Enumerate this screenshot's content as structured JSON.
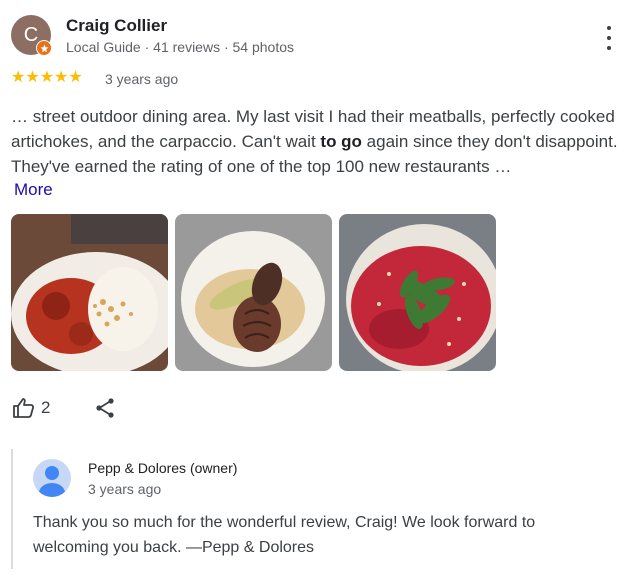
{
  "reviewer": {
    "name": "Craig Collier",
    "initial": "C",
    "meta": "Local Guide · 41 reviews · 54 photos",
    "badge_color": "#e8711a",
    "avatar_color": "#8d6e63"
  },
  "review": {
    "rating": 5,
    "stars": "★★★★★",
    "age": "3 years ago",
    "text_before": "… street outdoor dining area. My last visit I had their meatballs, perfectly cooked artichokes, and the carpaccio. Can't wait ",
    "text_bold": "to go",
    "text_after": " again since they don't disappoint. They've earned the rating of one of the top 100 new restaurants …",
    "more_label": "More",
    "photos": [
      {
        "icon": "meatballs-photo"
      },
      {
        "icon": "artichoke-photo"
      },
      {
        "icon": "carpaccio-photo"
      }
    ]
  },
  "actions": {
    "like_count": "2",
    "like_icon": "thumbs-up-icon",
    "share_icon": "share-icon"
  },
  "owner_reply": {
    "name": "Pepp & Dolores (owner)",
    "age": "3 years ago",
    "text": "Thank you so much for the wonderful review, Craig! We look forward to welcoming you back. —Pepp & Dolores"
  },
  "colors": {
    "star": "#fbbc04",
    "link": "#1a0dab",
    "owner_avatar": "#4285f4"
  }
}
